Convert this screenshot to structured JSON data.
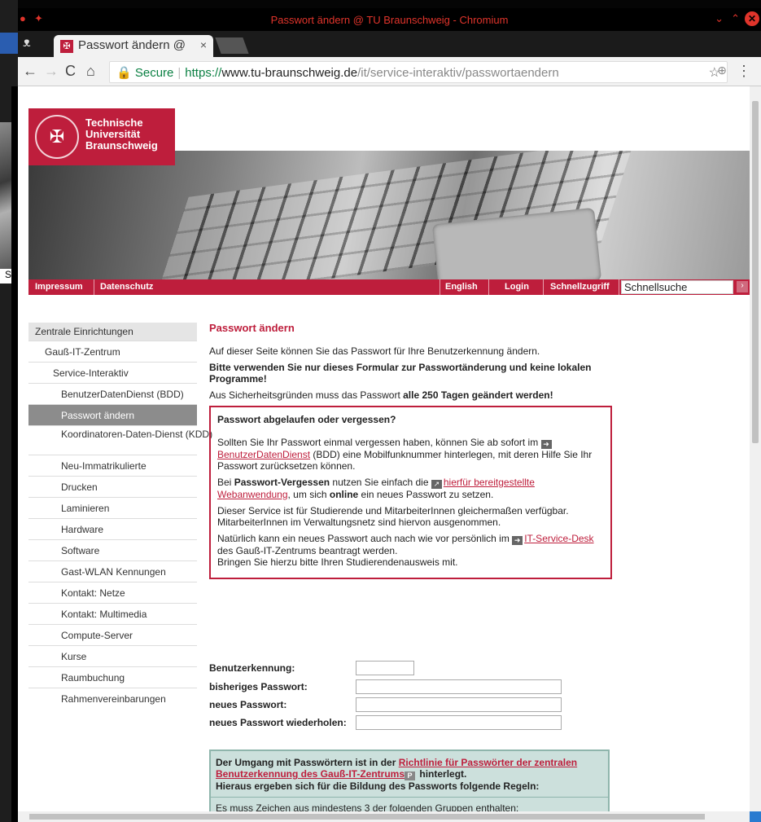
{
  "window": {
    "title": "Passwort ändern @ TU Braunschweig - Chromium"
  },
  "tab": {
    "title": "Passwort ändern @",
    "favicon": "tu-logo-icon"
  },
  "address": {
    "secure_label": "Secure",
    "scheme": "https://",
    "host": "www.tu-braunschweig.de",
    "path": "/it/service-interaktiv/passwortaendern"
  },
  "desktop": {
    "letter": "S"
  },
  "logo": {
    "line1": "Technische",
    "line2": "Universität",
    "line3": "Braunschweig"
  },
  "redbar": {
    "impressum": "Impressum",
    "datenschutz": "Datenschutz",
    "english": "English",
    "login": "Login",
    "schnellzugriff": "Schnellzugriff",
    "search_value": "Schnellsuche"
  },
  "nav": [
    {
      "label": "Zentrale Einrichtungen"
    },
    {
      "label": "Gauß-IT-Zentrum"
    },
    {
      "label": "Service-Interaktiv"
    },
    {
      "label": "BenutzerDatenDienst (BDD)"
    },
    {
      "label": "Passwort ändern"
    },
    {
      "label": "Koordinatoren-Daten-Dienst (KDD)"
    },
    {
      "label": "Neu-Immatrikulierte"
    },
    {
      "label": "Drucken"
    },
    {
      "label": "Laminieren"
    },
    {
      "label": "Hardware"
    },
    {
      "label": "Software"
    },
    {
      "label": "Gast-WLAN Kennungen"
    },
    {
      "label": "Kontakt: Netze"
    },
    {
      "label": "Kontakt: Multimedia"
    },
    {
      "label": "Compute-Server"
    },
    {
      "label": "Kurse"
    },
    {
      "label": "Raumbuchung"
    },
    {
      "label": "Rahmenvereinbarungen"
    }
  ],
  "content": {
    "heading": "Passwort ändern",
    "intro": "Auf dieser Seite können Sie das Passwort für Ihre Benutzerkennung ändern.",
    "warning": "Bitte verwenden Sie nur dieses Formular zur Passwortänderung und keine lokalen Programme!",
    "security_pre": "Aus Sicherheitsgründen muss das Passwort ",
    "security_bold": "alle 250 Tagen geändert werden!",
    "box": {
      "title": "Passwort abgelaufen oder vergessen?",
      "p1_a": "Sollten Sie Ihr Passwort einmal vergessen haben, können Sie ab sofort im ",
      "p1_link": "BenutzerDatenDienst",
      "p1_b": " (BDD) eine Mobilfunknummer hinterlegen, mit deren Hilfe Sie Ihr Passwort zurücksetzen können.",
      "p2_a": "Bei ",
      "p2_bold": "Passwort-Vergessen",
      "p2_b": " nutzen Sie einfach die ",
      "p2_link": "hierfür bereitgestellte Webanwendung",
      "p2_c": ", um sich ",
      "p2_bold2": "online",
      "p2_d": " ein neues Passwort zu setzen.",
      "p3": "Dieser Service ist für Studierende und MitarbeiterInnen gleichermaßen verfügbar. MitarbeiterInnen im Verwaltungsnetz sind hiervon ausgenommen.",
      "p4_a": "Natürlich kann ein neues Passwort auch nach wie vor persönlich im ",
      "p4_link": "IT-Service-Desk",
      "p4_b": " des Gauß-IT-Zentrums beantragt werden.",
      "p4_c": "Bringen Sie hierzu bitte Ihren Studierendenausweis mit."
    },
    "form": {
      "user_label": "Benutzerkennung:",
      "old_label": "bisheriges Passwort:",
      "new_label": "neues Passwort:",
      "repeat_label": "neues Passwort wiederholen:"
    },
    "green": {
      "a": "Der Umgang mit Passwörtern ist in der ",
      "link": "Richtlinie für Passwörter der zentralen Benutzerkennung des Gauß-IT-Zentrums",
      "b": " hinterlegt.",
      "c": "Hieraus ergeben sich für die Bildung des Passworts folgende Regeln:",
      "d": "Es muss Zeichen aus mindestens 3 der folgenden Gruppen enthalten:"
    }
  },
  "colors": {
    "brand": "#be1e3c",
    "nav_active": "#8c8c8c",
    "green_box": "#cce0dc"
  }
}
